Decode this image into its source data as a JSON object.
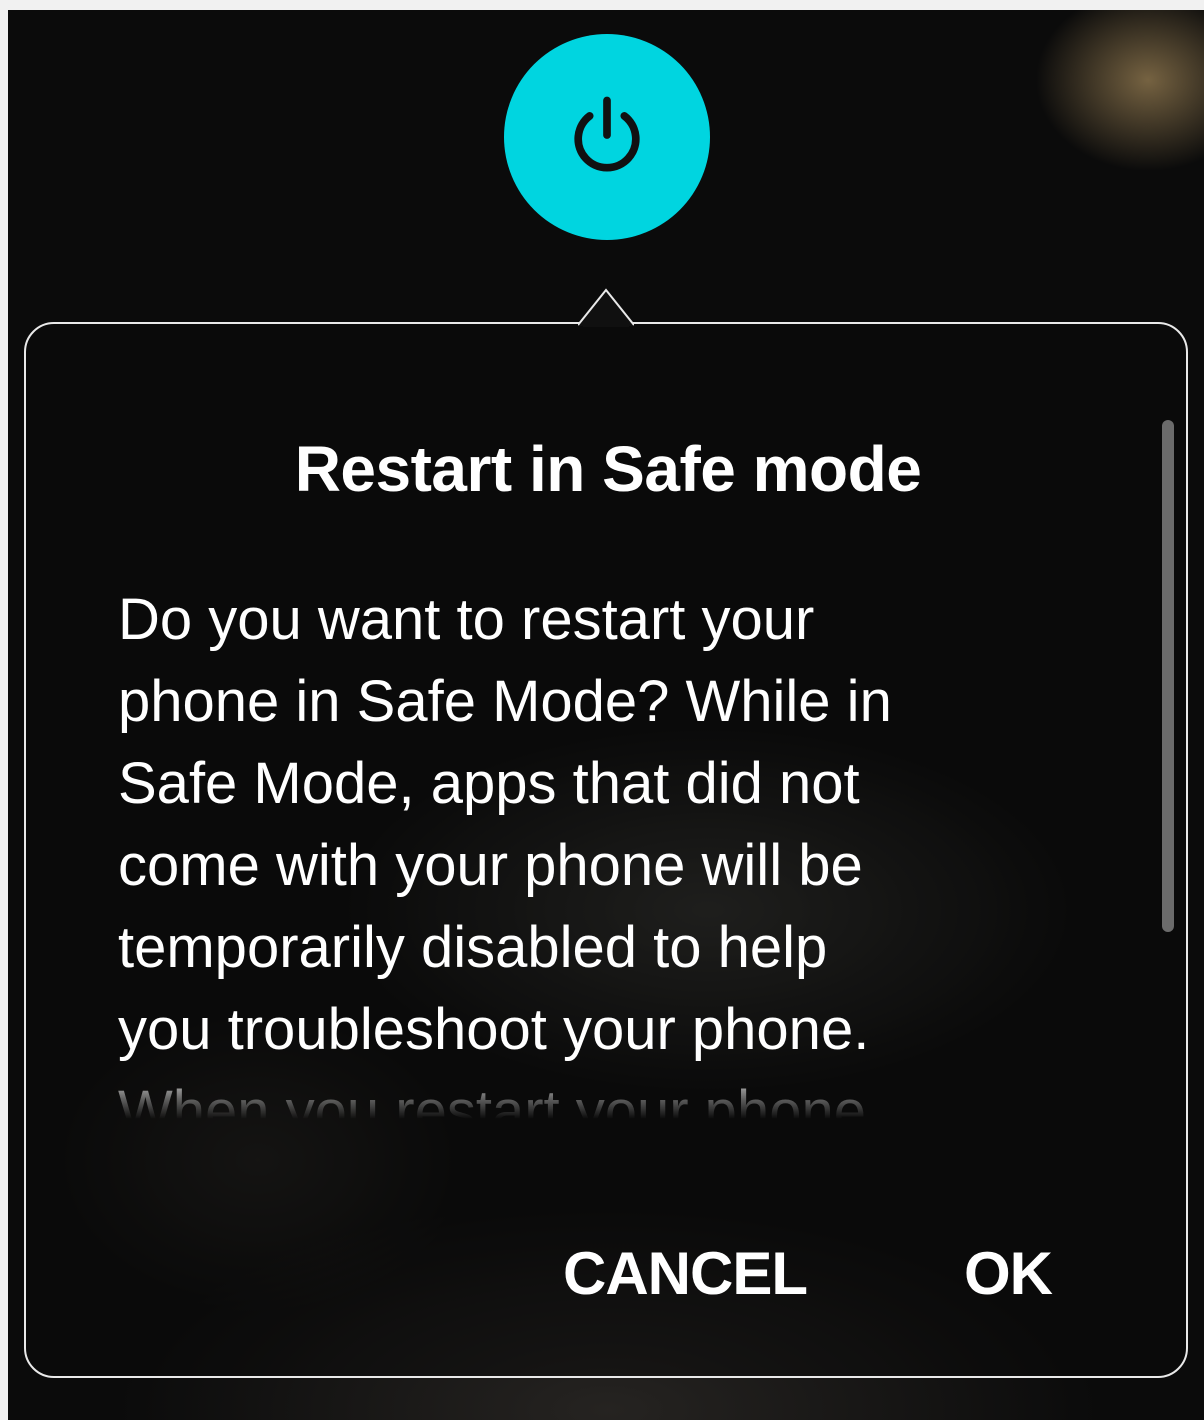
{
  "dialog": {
    "title": "Restart in Safe mode",
    "body_lines": [
      "Do you want to restart your",
      "phone in Safe Mode?  While in",
      "Safe Mode, apps that did not",
      "come with your phone will be",
      "temporarily disabled to help",
      "you troubleshoot your phone.",
      "When you restart your phone"
    ],
    "buttons": {
      "cancel": "CANCEL",
      "ok": "OK"
    }
  },
  "icons": {
    "power": "power-icon"
  },
  "colors": {
    "accent": "#00d5e0",
    "background": "#0b0b0b",
    "text": "#ffffff",
    "border": "#e9e9e9"
  }
}
